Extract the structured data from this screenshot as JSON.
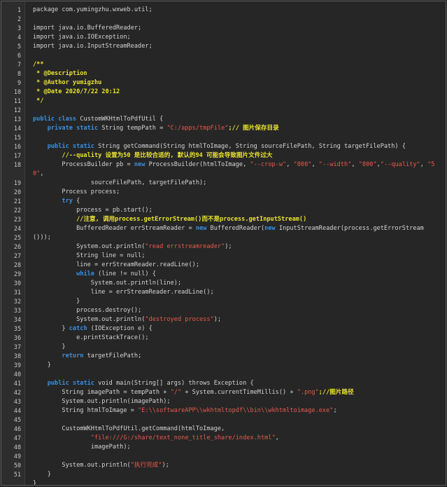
{
  "editor": {
    "lines": [
      {
        "n": "1",
        "parts": [
          {
            "t": "package com.yumingzhu.wxweb.util;",
            "c": "tx"
          }
        ]
      },
      {
        "n": "2",
        "parts": []
      },
      {
        "n": "3",
        "parts": [
          {
            "t": "import java.io.BufferedReader;",
            "c": "tx"
          }
        ]
      },
      {
        "n": "4",
        "parts": [
          {
            "t": "import java.io.IOException;",
            "c": "tx"
          }
        ]
      },
      {
        "n": "5",
        "parts": [
          {
            "t": "import java.io.InputStreamReader;",
            "c": "tx"
          }
        ]
      },
      {
        "n": "6",
        "parts": []
      },
      {
        "n": "7",
        "parts": [
          {
            "t": "/**",
            "c": "cm"
          }
        ]
      },
      {
        "n": "8",
        "parts": [
          {
            "t": " * @Description",
            "c": "cm"
          }
        ]
      },
      {
        "n": "9",
        "parts": [
          {
            "t": " * @Author yumigzhu",
            "c": "cm"
          }
        ]
      },
      {
        "n": "10",
        "parts": [
          {
            "t": " * @Date 2020/7/22 20:12",
            "c": "cm"
          }
        ]
      },
      {
        "n": "11",
        "parts": [
          {
            "t": " */",
            "c": "cm"
          }
        ]
      },
      {
        "n": "12",
        "parts": []
      },
      {
        "n": "13",
        "parts": [
          {
            "t": "public class",
            "c": "kw"
          },
          {
            "t": " CustomWKHtmlToPdfUtil {",
            "c": "tx"
          }
        ]
      },
      {
        "n": "14",
        "parts": [
          {
            "t": "    ",
            "c": "tx"
          },
          {
            "t": "private static",
            "c": "kw"
          },
          {
            "t": " String tempPath = ",
            "c": "tx"
          },
          {
            "t": "\"C:/apps/tmpFile\"",
            "c": "str"
          },
          {
            "t": ";// 图片保存目录",
            "c": "cm"
          }
        ]
      },
      {
        "n": "15",
        "parts": []
      },
      {
        "n": "16",
        "parts": [
          {
            "t": "    ",
            "c": "tx"
          },
          {
            "t": "public static",
            "c": "kw"
          },
          {
            "t": " String getCommand(String htmlToImage, String sourceFilePath, String targetFilePath) {",
            "c": "tx"
          }
        ]
      },
      {
        "n": "17",
        "parts": [
          {
            "t": "        //--quality 设置为50 是比较合适的, 默认的94 可能会导致图片文件过大",
            "c": "cm"
          }
        ]
      },
      {
        "n": "18",
        "parts": [
          {
            "t": "        ProcessBuilder pb = ",
            "c": "tx"
          },
          {
            "t": "new",
            "c": "kw"
          },
          {
            "t": " ProcessBuilder(htmlToImage, ",
            "c": "tx"
          },
          {
            "t": "\"--crop-w\"",
            "c": "str"
          },
          {
            "t": ", ",
            "c": "tx"
          },
          {
            "t": "\"800\"",
            "c": "str"
          },
          {
            "t": ", ",
            "c": "tx"
          },
          {
            "t": "\"--width\"",
            "c": "str"
          },
          {
            "t": ", ",
            "c": "tx"
          },
          {
            "t": "\"800\"",
            "c": "str"
          },
          {
            "t": ",",
            "c": "tx"
          },
          {
            "t": "\"--quality\"",
            "c": "str"
          },
          {
            "t": ", ",
            "c": "tx"
          },
          {
            "t": "\"5",
            "c": "str"
          }
        ]
      },
      {
        "n": "",
        "parts": [
          {
            "t": "0\"",
            "c": "str"
          },
          {
            "t": ",",
            "c": "tx"
          }
        ]
      },
      {
        "n": "19",
        "parts": [
          {
            "t": "                sourceFilePath, targetFilePath);",
            "c": "tx"
          }
        ]
      },
      {
        "n": "20",
        "parts": [
          {
            "t": "        Process process;",
            "c": "tx"
          }
        ]
      },
      {
        "n": "21",
        "parts": [
          {
            "t": "        ",
            "c": "tx"
          },
          {
            "t": "try",
            "c": "kw"
          },
          {
            "t": " {",
            "c": "tx"
          }
        ]
      },
      {
        "n": "22",
        "parts": [
          {
            "t": "            process = pb.start();",
            "c": "tx"
          }
        ]
      },
      {
        "n": "23",
        "parts": [
          {
            "t": "            //注意, 调用process.getErrorStream()而不是process.getInputStream()",
            "c": "cm"
          }
        ]
      },
      {
        "n": "24",
        "parts": [
          {
            "t": "            BufferedReader errStreamReader = ",
            "c": "tx"
          },
          {
            "t": "new",
            "c": "kw"
          },
          {
            "t": " BufferedReader(",
            "c": "tx"
          },
          {
            "t": "new",
            "c": "kw"
          },
          {
            "t": " InputStreamReader(process.getErrorStream",
            "c": "tx"
          }
        ]
      },
      {
        "n": "25",
        "parts": [
          {
            "t": "()));",
            "c": "tx"
          }
        ]
      },
      {
        "n": "26",
        "parts": [
          {
            "t": "            System.out.println(",
            "c": "tx"
          },
          {
            "t": "\"read errstreamreader\"",
            "c": "str"
          },
          {
            "t": ");",
            "c": "tx"
          }
        ]
      },
      {
        "n": "27",
        "parts": [
          {
            "t": "            String line = null;",
            "c": "tx"
          }
        ]
      },
      {
        "n": "28",
        "parts": [
          {
            "t": "            line = errStreamReader.readLine();",
            "c": "tx"
          }
        ]
      },
      {
        "n": "29",
        "parts": [
          {
            "t": "            ",
            "c": "tx"
          },
          {
            "t": "while",
            "c": "kw"
          },
          {
            "t": " (line != null) {",
            "c": "tx"
          }
        ]
      },
      {
        "n": "30",
        "parts": [
          {
            "t": "                System.out.println(line);",
            "c": "tx"
          }
        ]
      },
      {
        "n": "31",
        "parts": [
          {
            "t": "                line = errStreamReader.readLine();",
            "c": "tx"
          }
        ]
      },
      {
        "n": "32",
        "parts": [
          {
            "t": "            }",
            "c": "tx"
          }
        ]
      },
      {
        "n": "33",
        "parts": [
          {
            "t": "            process.destroy();",
            "c": "tx"
          }
        ]
      },
      {
        "n": "34",
        "parts": [
          {
            "t": "            System.out.println(",
            "c": "tx"
          },
          {
            "t": "\"destroyed process\"",
            "c": "str"
          },
          {
            "t": ");",
            "c": "tx"
          }
        ]
      },
      {
        "n": "35",
        "parts": [
          {
            "t": "        } ",
            "c": "tx"
          },
          {
            "t": "catch",
            "c": "kw"
          },
          {
            "t": " (IOException e) {",
            "c": "tx"
          }
        ]
      },
      {
        "n": "36",
        "parts": [
          {
            "t": "            e.printStackTrace();",
            "c": "tx"
          }
        ]
      },
      {
        "n": "37",
        "parts": [
          {
            "t": "        }",
            "c": "tx"
          }
        ]
      },
      {
        "n": "38",
        "parts": [
          {
            "t": "        ",
            "c": "tx"
          },
          {
            "t": "return",
            "c": "kw"
          },
          {
            "t": " targetFilePath;",
            "c": "tx"
          }
        ]
      },
      {
        "n": "39",
        "parts": [
          {
            "t": "    }",
            "c": "tx"
          }
        ]
      },
      {
        "n": "40",
        "parts": []
      },
      {
        "n": "41",
        "parts": [
          {
            "t": "    ",
            "c": "tx"
          },
          {
            "t": "public static",
            "c": "kw"
          },
          {
            "t": " void main(String[] args) throws Exception {",
            "c": "tx"
          }
        ]
      },
      {
        "n": "42",
        "parts": [
          {
            "t": "        String imagePath = tempPath + ",
            "c": "tx"
          },
          {
            "t": "\"/\"",
            "c": "str"
          },
          {
            "t": " + System.currentTimeMillis() + ",
            "c": "tx"
          },
          {
            "t": "\".png\"",
            "c": "str"
          },
          {
            "t": ";//图片路径",
            "c": "cm"
          }
        ]
      },
      {
        "n": "43",
        "parts": [
          {
            "t": "        System.out.println(imagePath);",
            "c": "tx"
          }
        ]
      },
      {
        "n": "44",
        "parts": [
          {
            "t": "        String htmlToImage = ",
            "c": "tx"
          },
          {
            "t": "\"E:\\\\softwareAPP\\\\wkhtmltopdf\\\\bin\\\\wkhtmltoimage.exe\"",
            "c": "str"
          },
          {
            "t": ";",
            "c": "tx"
          }
        ]
      },
      {
        "n": "45",
        "parts": []
      },
      {
        "n": "46",
        "parts": [
          {
            "t": "        CustomWKHtmlToPdfUtil.getCommand(htmlToImage,",
            "c": "tx"
          }
        ]
      },
      {
        "n": "47",
        "parts": [
          {
            "t": "                ",
            "c": "tx"
          },
          {
            "t": "\"file:///G:/share/text_none_title_share/index.html\"",
            "c": "str"
          },
          {
            "t": ",",
            "c": "tx"
          }
        ]
      },
      {
        "n": "48",
        "parts": [
          {
            "t": "                imagePath);",
            "c": "tx"
          }
        ]
      },
      {
        "n": "49",
        "parts": []
      },
      {
        "n": "50",
        "parts": [
          {
            "t": "        System.out.println(",
            "c": "tx"
          },
          {
            "t": "\"执行完成\"",
            "c": "str"
          },
          {
            "t": ");",
            "c": "tx"
          }
        ]
      },
      {
        "n": "51",
        "parts": [
          {
            "t": "    }",
            "c": "tx"
          }
        ]
      },
      {
        "n": "",
        "parts": [
          {
            "t": "}",
            "c": "tx"
          }
        ]
      }
    ]
  }
}
